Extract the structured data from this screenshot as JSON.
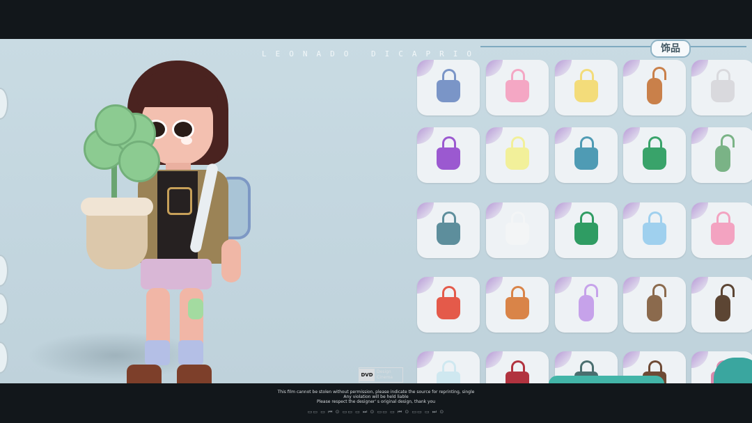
{
  "header": {
    "film_title": "LEONADO DICAPRIO",
    "category_label": "饰品"
  },
  "scene": {
    "character": "avatar-girl-with-clover-plant",
    "background_color": "#c6d8e0"
  },
  "inventory": {
    "rows": [
      [
        {
          "name": "bear-shoulder-bag-icon",
          "color": "#7a95c7"
        },
        {
          "name": "pink-puppy-tote-icon",
          "color": "#f4a7c4"
        },
        {
          "name": "yellow-duck-tote-icon",
          "color": "#f3dc7a"
        },
        {
          "name": "trumpet-ribbon-charm-icon",
          "color": "#c9804a"
        },
        {
          "name": "cat-plush-bag-icon",
          "color": "#d9d9dd"
        }
      ],
      [
        {
          "name": "purple-gem-bag-icon",
          "color": "#9b59d0"
        },
        {
          "name": "yellow-knot-bag-icon",
          "color": "#f2f09a"
        },
        {
          "name": "blue-knot-bag-icon",
          "color": "#4f9bb4"
        },
        {
          "name": "green-knot-bag-icon",
          "color": "#39a36a"
        },
        {
          "name": "green-sword-charm-icon",
          "color": "#7ab386"
        }
      ],
      [
        {
          "name": "teal-canvas-tote-icon",
          "color": "#5d8e9c"
        },
        {
          "name": "white-canvas-tote-icon",
          "color": "#f3f5f6"
        },
        {
          "name": "green-checker-tote-icon",
          "color": "#2f9c63"
        },
        {
          "name": "blue-flower-tote-icon",
          "color": "#9fd0ee"
        },
        {
          "name": "pink-flower-tote-icon",
          "color": "#f3a3c1"
        }
      ],
      [
        {
          "name": "red-heart-tote-icon",
          "color": "#e45a4a"
        },
        {
          "name": "autumn-flower-bouquet-icon",
          "color": "#d98448"
        },
        {
          "name": "purple-crystal-charm-icon",
          "color": "#c6a2ea"
        },
        {
          "name": "gourd-charm-icon",
          "color": "#8b6a4d"
        },
        {
          "name": "folding-fan-icon",
          "color": "#5c4533"
        }
      ],
      [
        {
          "name": "glass-bead-bag-icon",
          "color": "#cfe8f0"
        },
        {
          "name": "red-strap-bag-icon",
          "color": "#b1333f"
        },
        {
          "name": "teal-strap-bag-icon",
          "color": "#4a6e6f"
        },
        {
          "name": "leather-strap-bag-icon",
          "color": "#6e4a35"
        },
        {
          "name": "pink-strap-bag-icon",
          "color": "#d989ac"
        }
      ]
    ]
  },
  "footer": {
    "logo_dvd": "DVD",
    "logo_line1": "Design",
    "logo_line2": "Cinema",
    "notice_line1": "This film cannot be stolen without permission, please indicate the source for reprinting, single",
    "notice_line2": "Any violation will be held liable",
    "notice_line3": "Please respect the designer' s original design, thank you",
    "controls": "▭▭ ▭ ⏮ ⊙ ▭▭ ▭ ⏭ ⊙ ▭▭ ▭ ⏮ ⊙ ▭▭ ▭ ⏭ ⊙"
  }
}
